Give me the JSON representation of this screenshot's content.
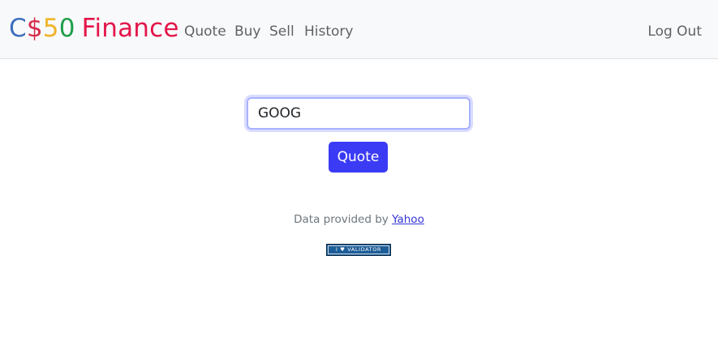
{
  "navbar": {
    "brand": {
      "parts": [
        {
          "text": "C",
          "color": "#3f6fbf"
        },
        {
          "text": "$",
          "color": "#d62848"
        },
        {
          "text": "5",
          "color": "#f0b429"
        },
        {
          "text": "0",
          "color": "#1e9e4a"
        },
        {
          "text": "Finance",
          "color": "#e3164a"
        }
      ]
    },
    "links": {
      "quote": "Quote",
      "buy": "Buy",
      "sell": "Sell",
      "history": "History",
      "logout": "Log Out"
    }
  },
  "form": {
    "symbol_value": "GOOG",
    "submit_label": "Quote"
  },
  "footer": {
    "attribution_prefix": "Data provided by",
    "attribution_link": "Yahoo",
    "badge_text": "I ♥ VALIDATOR"
  }
}
